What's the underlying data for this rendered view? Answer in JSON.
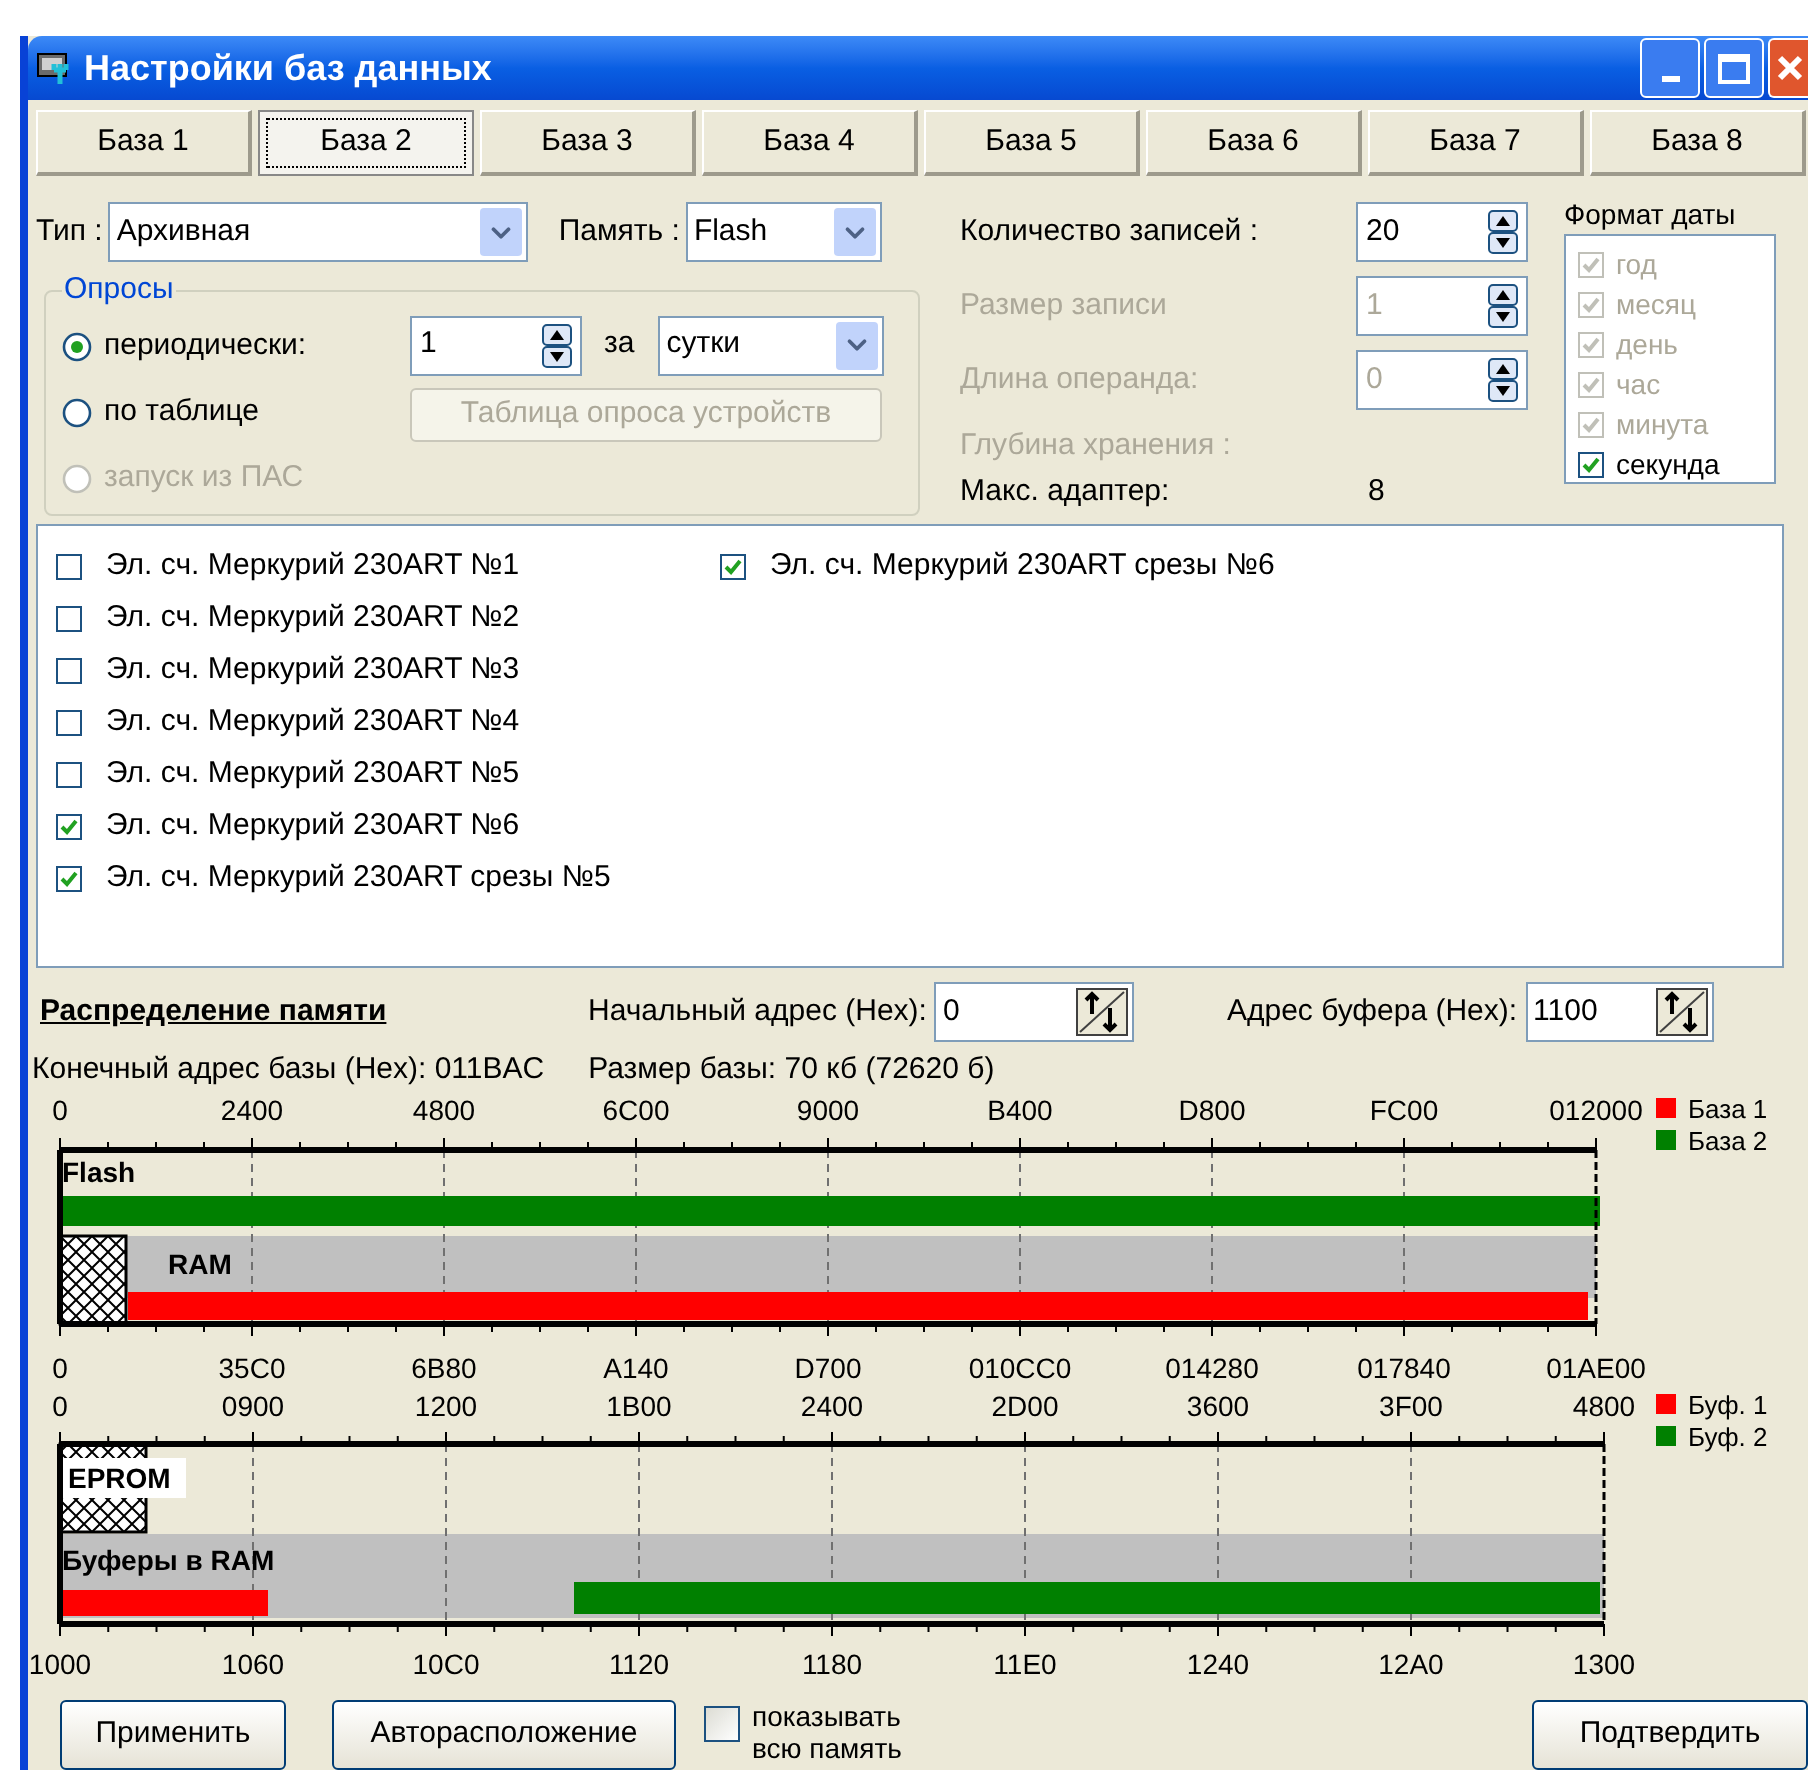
{
  "window": {
    "title": "Настройки баз данных"
  },
  "tabs": [
    {
      "label": "База 1",
      "selected": false
    },
    {
      "label": "База 2",
      "selected": true
    },
    {
      "label": "База 3",
      "selected": false
    },
    {
      "label": "База 4",
      "selected": false
    },
    {
      "label": "База 5",
      "selected": false
    },
    {
      "label": "База 6",
      "selected": false
    },
    {
      "label": "База 7",
      "selected": false
    },
    {
      "label": "База 8",
      "selected": false
    }
  ],
  "type_field": {
    "label": "Тип :",
    "value": "Архивная"
  },
  "memory_field": {
    "label": "Память :",
    "value": "Flash"
  },
  "polling": {
    "title": "Опросы",
    "options": [
      {
        "label": "периодически:",
        "selected": true,
        "disabled": false
      },
      {
        "label": "по таблице",
        "selected": false,
        "disabled": false
      },
      {
        "label": "запуск из ПАС",
        "selected": false,
        "disabled": true
      }
    ],
    "period": {
      "value": "1",
      "connector": "за",
      "unit": "сутки"
    },
    "table_button": {
      "label": "Таблица опроса устройств",
      "disabled": true
    }
  },
  "record_fields": [
    {
      "label": "Количество записей :",
      "value": "20",
      "disabled": false
    },
    {
      "label": "Размер записи",
      "value": "1",
      "disabled": true
    },
    {
      "label": "Длина операнда:",
      "value": "0",
      "disabled": true
    }
  ],
  "storage_depth": {
    "label": "Глубина хранения :",
    "disabled": true
  },
  "max_adapter": {
    "label": "Макс. адаптер:",
    "value": "8"
  },
  "date_format": {
    "title": "Формат даты",
    "items": [
      {
        "label": "год",
        "checked": true,
        "disabled": true
      },
      {
        "label": "месяц",
        "checked": true,
        "disabled": true
      },
      {
        "label": "день",
        "checked": true,
        "disabled": true
      },
      {
        "label": "час",
        "checked": true,
        "disabled": true
      },
      {
        "label": "минута",
        "checked": true,
        "disabled": true
      },
      {
        "label": "секунда",
        "checked": true,
        "disabled": false
      }
    ]
  },
  "devices": [
    [
      {
        "label": "Эл. сч. Меркурий 230ART №1",
        "checked": false
      },
      {
        "label": "Эл. сч. Меркурий 230ART №2",
        "checked": false
      },
      {
        "label": "Эл. сч. Меркурий 230ART №3",
        "checked": false
      },
      {
        "label": "Эл. сч. Меркурий 230ART №4",
        "checked": false
      },
      {
        "label": "Эл. сч. Меркурий 230ART №5",
        "checked": false
      },
      {
        "label": "Эл. сч. Меркурий 230ART №6",
        "checked": true
      },
      {
        "label": "Эл. сч. Меркурий 230ART срезы №5",
        "checked": true
      }
    ],
    [
      {
        "label": "Эл. сч. Меркурий 230ART срезы №6",
        "checked": true
      }
    ]
  ],
  "memory": {
    "title": "Распределение памяти",
    "start_address": {
      "label": "Начальный адрес (Hex):",
      "value": "0"
    },
    "buffer_address": {
      "label": "Адрес буфера (Hex):",
      "value": "1100"
    },
    "end_address": "Конечный адрес базы (Hex): 011BAC",
    "base_size": "Размер базы: 70 кб (72620 б)"
  },
  "memory_map": {
    "top_ticks": [
      "0",
      "2400",
      "4800",
      "6C00",
      "9000",
      "B400",
      "D800",
      "FC00",
      "012000"
    ],
    "bottom_ticks": [
      "0",
      "35C0",
      "6B80",
      "A140",
      "D700",
      "010CC0",
      "014280",
      "017840",
      "01AE00"
    ],
    "regions": [
      "Flash",
      "RAM"
    ],
    "legend": [
      {
        "label": "База 1",
        "color": "#ff0000"
      },
      {
        "label": "База 2",
        "color": "#008000"
      }
    ]
  },
  "buffer_map": {
    "top_ticks": [
      "0",
      "0900",
      "1200",
      "1B00",
      "2400",
      "2D00",
      "3600",
      "3F00",
      "4800"
    ],
    "bottom_ticks": [
      "1000",
      "1060",
      "10C0",
      "1120",
      "1180",
      "11E0",
      "1240",
      "12A0",
      "1300"
    ],
    "regions": [
      "EPROM",
      "Буферы в RAM"
    ],
    "legend": [
      {
        "label": "Буф. 1",
        "color": "#ff0000"
      },
      {
        "label": "Буф. 2",
        "color": "#008000"
      }
    ]
  },
  "buttons": {
    "apply": "Применить",
    "auto": "Авторасположение",
    "show_all": {
      "label": "показывать всю память",
      "checked": false
    },
    "confirm": "Подтвердить"
  }
}
